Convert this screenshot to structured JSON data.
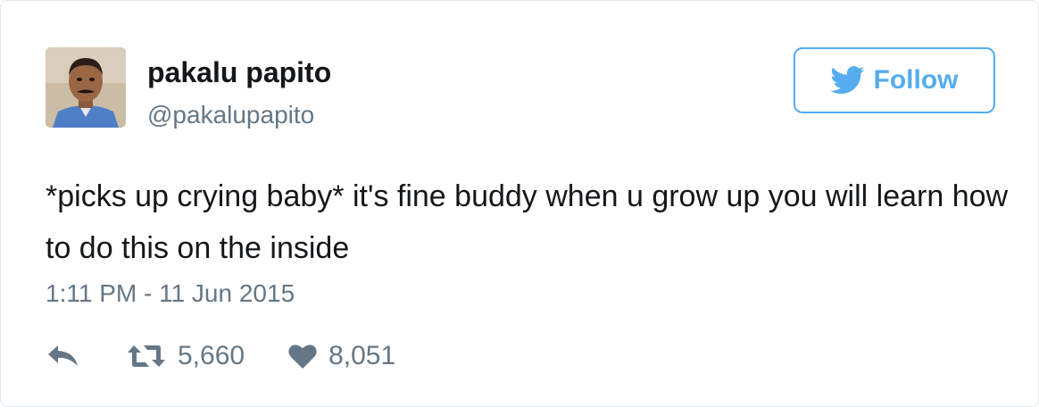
{
  "tweet": {
    "author": {
      "display_name": "pakalu papito",
      "handle": "@pakalupapito"
    },
    "follow_label": "Follow",
    "text": "*picks up crying baby* it's fine buddy when u grow up you will learn how to do this on the inside",
    "timestamp": "1:11 PM - 11 Jun 2015",
    "stats": {
      "retweets": "5,660",
      "likes": "8,051"
    }
  },
  "icons": {
    "follow": "bird-icon",
    "reply": "reply-icon",
    "retweet": "retweet-icon",
    "like": "heart-icon"
  },
  "colors": {
    "accent": "#55acee",
    "text": "#14171a",
    "secondary": "#657786",
    "border": "#e1e8ed"
  }
}
